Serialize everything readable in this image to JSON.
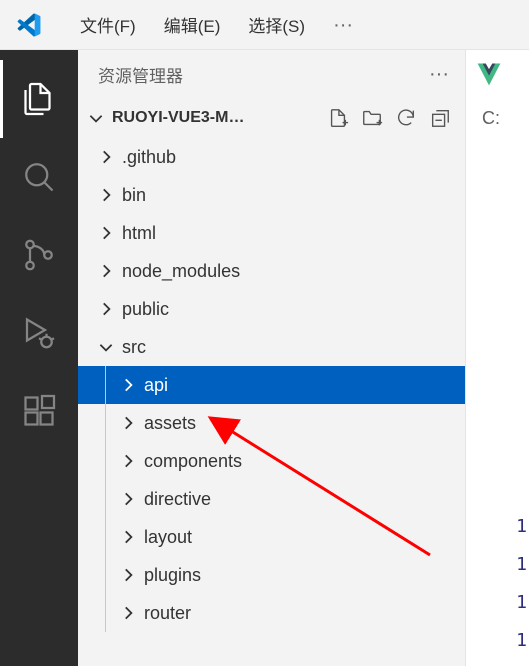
{
  "menu": {
    "file": "文件(F)",
    "edit": "编辑(E)",
    "select": "选择(S)"
  },
  "sidebar": {
    "title": "资源管理器",
    "project": "RUOYI-VUE3-M…"
  },
  "tree": [
    {
      "label": ".github",
      "depth": 0,
      "expanded": false,
      "selected": false
    },
    {
      "label": "bin",
      "depth": 0,
      "expanded": false,
      "selected": false
    },
    {
      "label": "html",
      "depth": 0,
      "expanded": false,
      "selected": false
    },
    {
      "label": "node_modules",
      "depth": 0,
      "expanded": false,
      "selected": false
    },
    {
      "label": "public",
      "depth": 0,
      "expanded": false,
      "selected": false
    },
    {
      "label": "src",
      "depth": 0,
      "expanded": true,
      "selected": false
    },
    {
      "label": "api",
      "depth": 1,
      "expanded": false,
      "selected": true
    },
    {
      "label": "assets",
      "depth": 1,
      "expanded": false,
      "selected": false
    },
    {
      "label": "components",
      "depth": 1,
      "expanded": false,
      "selected": false
    },
    {
      "label": "directive",
      "depth": 1,
      "expanded": false,
      "selected": false
    },
    {
      "label": "layout",
      "depth": 1,
      "expanded": false,
      "selected": false
    },
    {
      "label": "plugins",
      "depth": 1,
      "expanded": false,
      "selected": false
    },
    {
      "label": "router",
      "depth": 1,
      "expanded": false,
      "selected": false
    }
  ],
  "editor": {
    "breadcrumb_root": "C:",
    "line_numbers": [
      "1",
      "1",
      "1",
      "1"
    ]
  }
}
